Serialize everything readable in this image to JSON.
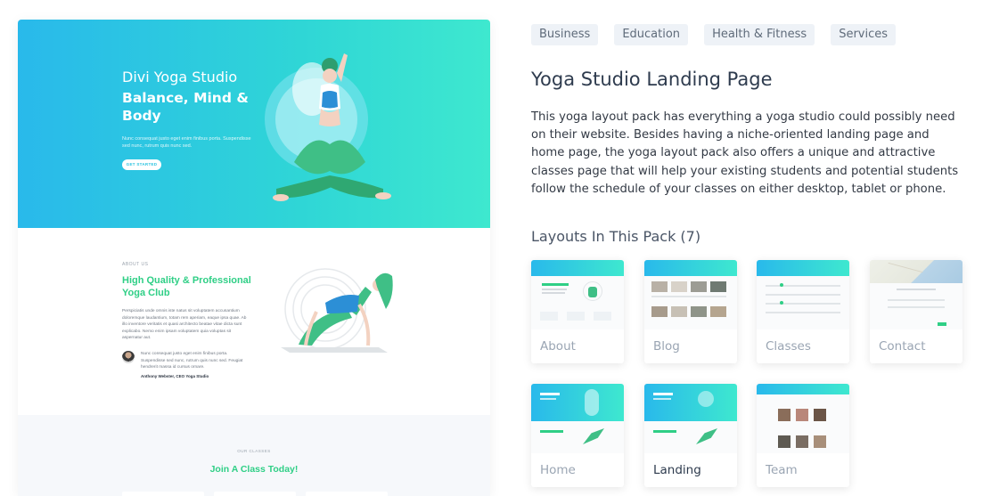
{
  "preview": {
    "hero": {
      "kicker": "Divi Yoga Studio",
      "title": "Balance, Mind & Body",
      "body": "Nunc consequat justo eget enim finibus porta. Suspendisse sed nunc, rutrum quis nunc sed.",
      "button": "GET STARTED"
    },
    "about": {
      "label": "ABOUT US",
      "title": "High Quality & Professional Yoga Club",
      "body": "Perspiciatis unde omnis iste natus sit voluptatem accusantium doloremque laudantium, totam rem aperiam, eaque ipsa quae. Ab illo inventore veritatis et quasi architecto beatae vitae dicta sunt explicabo. Nemo enim ipsam voluptatem quia voluptas sit aspernatur aut.",
      "quote": "Nunc consequat justo eget enim finibus porta. Suspendisse sed nunc, rutrum quis nunc sed. Feugiat hendrerit massa id cursus ornare.",
      "author": "Anthony Webster, CEO Yoga Studio"
    },
    "classes": {
      "label": "OUR CLASSES",
      "title": "Join A Class Today!"
    }
  },
  "tags": [
    "Business",
    "Education",
    "Health & Fitness",
    "Services"
  ],
  "title": "Yoga Studio Landing Page",
  "description": "This yoga layout pack has everything a yoga studio could possibly need on their website. Besides having a niche-oriented landing page and home page, the yoga layout pack also offers a unique and attractive classes page that will help your existing students and potential students follow the schedule of your classes on either desktop, tablet or phone.",
  "layouts_heading": "Layouts In This Pack (7)",
  "layouts": [
    {
      "label": "About"
    },
    {
      "label": "Blog"
    },
    {
      "label": "Classes"
    },
    {
      "label": "Contact"
    },
    {
      "label": "Home"
    },
    {
      "label": "Landing"
    },
    {
      "label": "Team"
    }
  ],
  "colors": {
    "accent_gradient_start": "#29b9eb",
    "accent_gradient_end": "#3ee8cf",
    "green": "#2fcf86",
    "text_dark": "#2e3b4e",
    "tag_bg": "#eef2f7"
  }
}
